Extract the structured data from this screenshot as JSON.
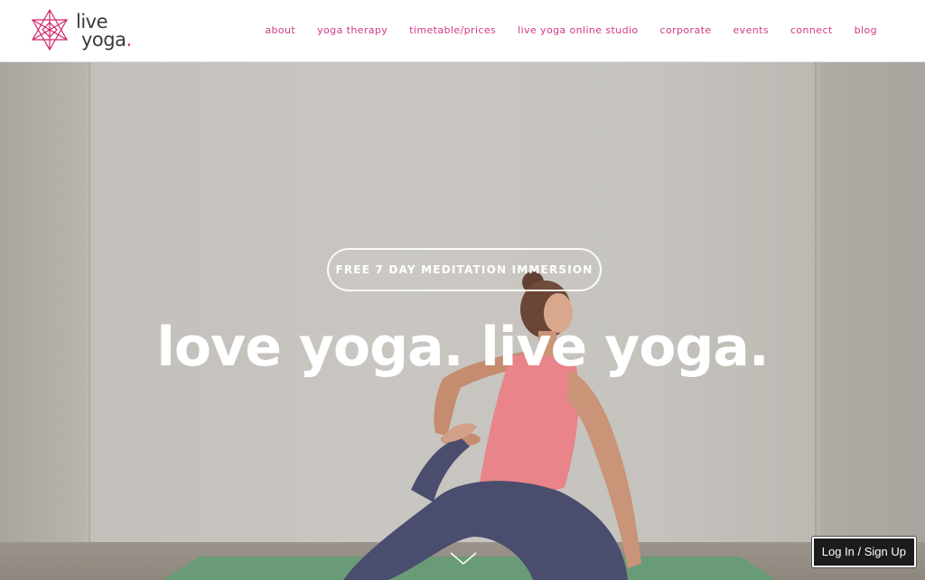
{
  "brand": {
    "name_line1": "live",
    "name_line2": "yoga",
    "name_dot": ".",
    "accent_color": "#d2236d"
  },
  "nav": {
    "items": [
      {
        "label": "about"
      },
      {
        "label": "yoga therapy"
      },
      {
        "label": "timetable/prices"
      },
      {
        "label": "live yoga online studio"
      },
      {
        "label": "corporate"
      },
      {
        "label": "events"
      },
      {
        "label": "connect"
      },
      {
        "label": "blog"
      }
    ],
    "color": "#d23a86"
  },
  "hero": {
    "cta_label": "FREE 7 DAY MEDITATION IMMERSION",
    "headline": "love yoga. live yoga.",
    "scroll_icon": "chevron-down-icon"
  },
  "account": {
    "login_label": "Log In / Sign Up"
  }
}
